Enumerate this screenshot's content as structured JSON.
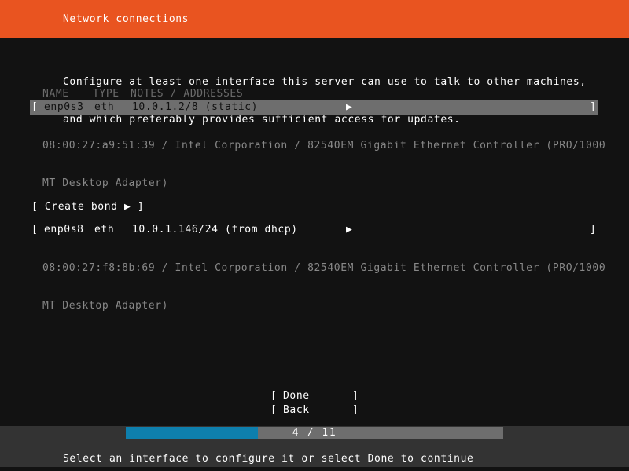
{
  "header": {
    "title": "Network connections"
  },
  "intro": {
    "line1": "Configure at least one interface this server can use to talk to other machines,",
    "line2": "and which preferably provides sufficient access for updates."
  },
  "table": {
    "columns": {
      "name": "NAME",
      "type": "TYPE",
      "notes": "NOTES / ADDRESSES"
    },
    "bracket_open": "[",
    "bracket_close": "]",
    "arrow": "▶",
    "interfaces": [
      {
        "name": "enp0s3",
        "type": "eth",
        "notes": "10.0.1.2/8 (static)",
        "desc_line1": "08:00:27:a9:51:39 / Intel Corporation / 82540EM Gigabit Ethernet Controller (PRO/1000",
        "desc_line2": "MT Desktop Adapter)",
        "selected": true
      },
      {
        "name": "enp0s8",
        "type": "eth",
        "notes": "10.0.1.146/24 (from dhcp)",
        "desc_line1": "08:00:27:f8:8b:69 / Intel Corporation / 82540EM Gigabit Ethernet Controller (PRO/1000",
        "desc_line2": "MT Desktop Adapter)",
        "selected": false
      }
    ]
  },
  "create_bond": {
    "text": "[ Create bond ▶ ]"
  },
  "buttons": {
    "done": {
      "open": "[",
      "label": "Done",
      "close": "]"
    },
    "back": {
      "open": "[",
      "label": "Back",
      "close": "]"
    }
  },
  "progress": {
    "current": 4,
    "total": 11,
    "label": "4 / 11",
    "percent": 35,
    "fill_color": "#0e7fad",
    "track_color": "#6e6e6e"
  },
  "footer": {
    "status": "Select an interface to configure it or select Done to continue"
  },
  "colors": {
    "accent": "#e95420",
    "background": "#121212",
    "highlight": "#6e6e6e",
    "dim_text": "#888888",
    "footer_band": "#333333"
  }
}
